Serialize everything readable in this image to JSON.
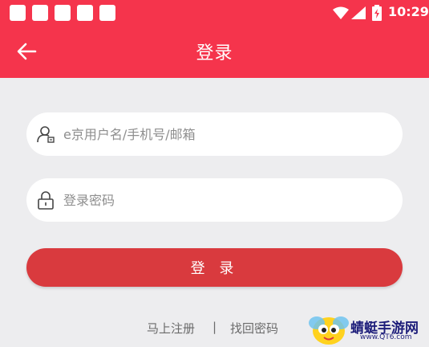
{
  "status_bar": {
    "time": "10:29",
    "notification_icons": [
      "app-icon",
      "app-icon",
      "app-icon",
      "app-icon",
      "app-icon"
    ],
    "wifi_icon": "wifi-icon",
    "signal_icon": "signal-icon",
    "battery_icon": "battery-charging-icon"
  },
  "header": {
    "title": "登录",
    "back_icon": "back-arrow-icon",
    "color": "#f5344c"
  },
  "form": {
    "username": {
      "value": "",
      "placeholder": "e京用户名/手机号/邮箱",
      "icon": "user-icon"
    },
    "password": {
      "value": "",
      "placeholder": "登录密码",
      "icon": "lock-icon"
    },
    "login_button": {
      "label": "登 录",
      "color": "#d93a3e"
    }
  },
  "footer": {
    "register_link": "马上注册",
    "separator": "|",
    "forgot_link": "找回密码"
  },
  "watermark": {
    "name": "蜻蜓手游网",
    "url": "www.QT6.com"
  }
}
